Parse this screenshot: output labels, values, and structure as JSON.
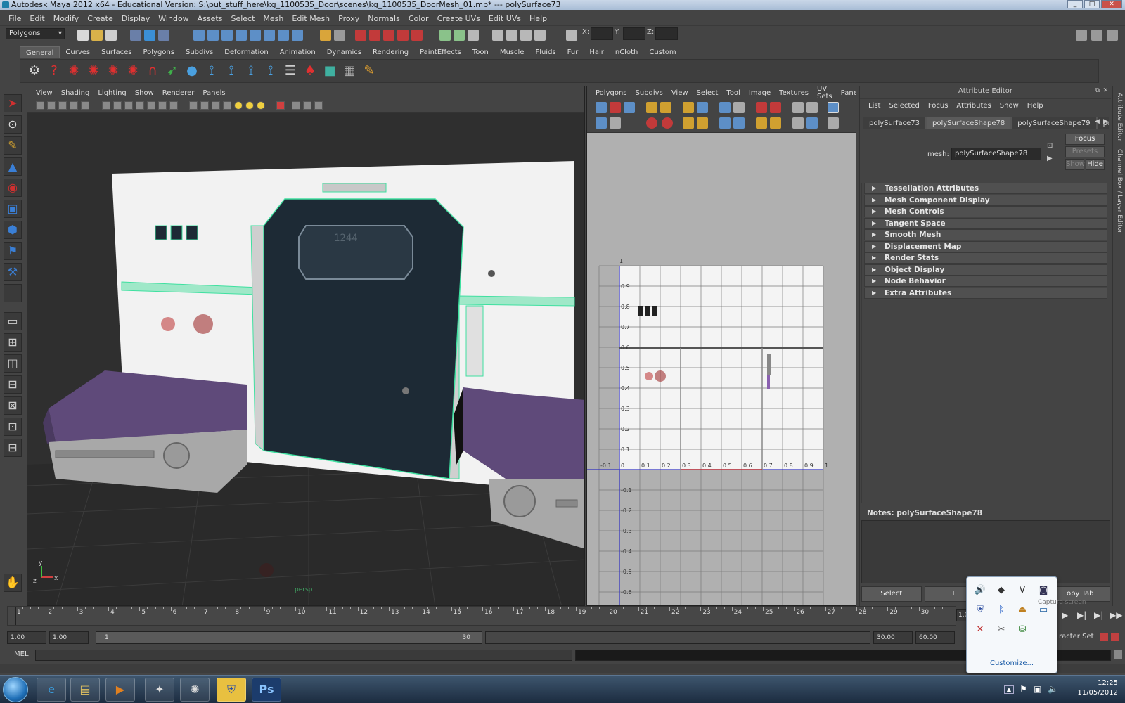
{
  "window": {
    "title": "Autodesk Maya 2012 x64 - Educational Version: S:\\put_stuff_here\\kg_1100535_Door\\scenes\\kg_1100535_DoorMesh_01.mb*  ---  polySurface73"
  },
  "menubar": [
    "File",
    "Edit",
    "Modify",
    "Create",
    "Display",
    "Window",
    "Assets",
    "Select",
    "Mesh",
    "Edit Mesh",
    "Proxy",
    "Normals",
    "Color",
    "Create UVs",
    "Edit UVs",
    "Help"
  ],
  "statusline": {
    "menuset": "Polygons",
    "x_label": "X:",
    "y_label": "Y:",
    "z_label": "Z:"
  },
  "shelf": {
    "tabs": [
      "General",
      "Curves",
      "Surfaces",
      "Polygons",
      "Subdivs",
      "Deformation",
      "Animation",
      "Dynamics",
      "Rendering",
      "PaintEffects",
      "Toon",
      "Muscle",
      "Fluids",
      "Fur",
      "Hair",
      "nCloth",
      "Custom"
    ],
    "active": "General"
  },
  "viewport": {
    "menu": [
      "View",
      "Shading",
      "Lighting",
      "Show",
      "Renderer",
      "Panels"
    ],
    "door_number": "1244",
    "camera_label": "persp",
    "colors": {
      "floor": "#2b2b2b",
      "wall": "#f2f2f2",
      "door": "#1d2a35",
      "purple": "#5f4a7a",
      "highlight": "#3fe0a0"
    }
  },
  "uv_editor": {
    "menu": [
      "Polygons",
      "Subdivs",
      "View",
      "Select",
      "Tool",
      "Image",
      "Textures",
      "UV Sets",
      "Panels"
    ],
    "v_labels": [
      "0.9",
      "0.8",
      "0.7",
      "0.6",
      "0.5",
      "0.4",
      "0.3",
      "0.2",
      "0.1"
    ],
    "u_labels": [
      "-0.1",
      "0",
      "0.1",
      "0.2",
      "0.3",
      "0.4",
      "0.5",
      "0.6",
      "0.7",
      "0.8",
      "0.9",
      "1"
    ],
    "neg_v_labels": [
      "-0.1",
      "-0.2",
      "-0.3",
      "-0.4",
      "-0.5",
      "-0.6"
    ],
    "top_label": "1"
  },
  "attribute_editor": {
    "title": "Attribute Editor",
    "menu": [
      "List",
      "Selected",
      "Focus",
      "Attributes",
      "Show",
      "Help"
    ],
    "tabs": [
      "polySurface73",
      "polySurfaceShape78",
      "polySurfaceShape79",
      "polyPlan"
    ],
    "active_tab": "polySurfaceShape78",
    "mesh_label": "mesh:",
    "mesh_value": "polySurfaceShape78",
    "buttons": {
      "focus": "Focus",
      "presets": "Presets",
      "show": "Show",
      "hide": "Hide"
    },
    "sections": [
      "Tessellation Attributes",
      "Mesh Component Display",
      "Mesh Controls",
      "Tangent Space",
      "Smooth Mesh",
      "Displacement Map",
      "Render Stats",
      "Object Display",
      "Node Behavior",
      "Extra Attributes"
    ],
    "notes_label": "Notes:  polySurfaceShape78",
    "bottom_buttons": [
      "Select",
      "L",
      "",
      "opy Tab"
    ]
  },
  "dock": {
    "tab1": "Attribute Editor",
    "tab2": "Channel Box / Layer Editor"
  },
  "timeslider": {
    "ticks": [
      "1",
      "2",
      "3",
      "4",
      "5",
      "6",
      "7",
      "8",
      "9",
      "10",
      "11",
      "12",
      "13",
      "14",
      "15",
      "16",
      "17",
      "18",
      "19",
      "20",
      "21",
      "22",
      "23",
      "24",
      "25",
      "26",
      "27",
      "28",
      "29",
      "30"
    ],
    "current": "1.00"
  },
  "rangeslider": {
    "start": "1.00",
    "anim_start": "1.00",
    "range_start": "1",
    "range_end": "30",
    "end": "30.00",
    "anim_end": "60.00",
    "char_set": "racter Set"
  },
  "commandline": {
    "label": "MEL"
  },
  "tray": {
    "customize": "Customize...",
    "tooltip": "Capture screen",
    "icons": [
      "speaker-icon",
      "diamond-icon",
      "vmware-icon",
      "camera-icon",
      "shield-icon",
      "bluetooth-icon",
      "usb-icon",
      "monitor-icon",
      "flash-icon",
      "tools-icon",
      "network-icon"
    ]
  },
  "clock": {
    "time": "12:25",
    "date": "11/05/2012"
  }
}
